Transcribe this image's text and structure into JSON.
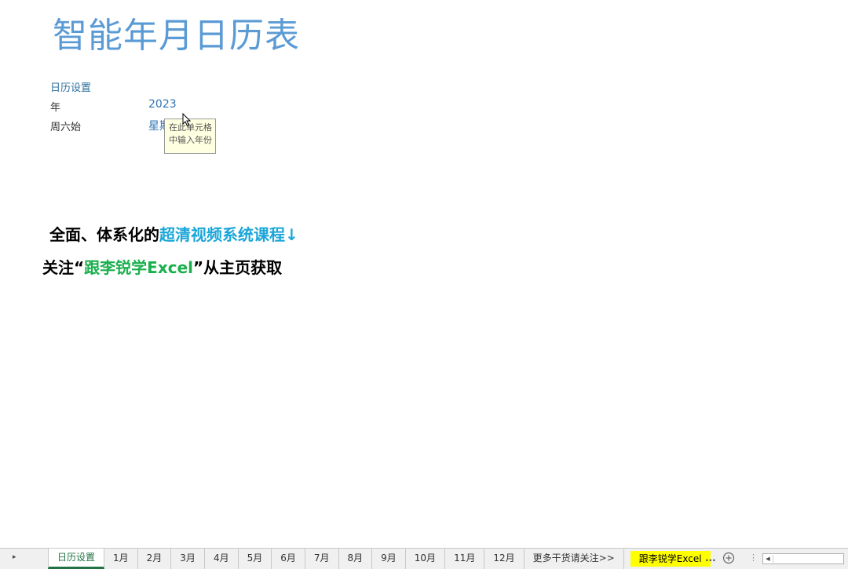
{
  "sheet": {
    "title": "智能年月日历表",
    "settings_heading": "日历设置",
    "rows": [
      {
        "label": "年",
        "value": "2023"
      },
      {
        "label": "周六始",
        "value": "星期"
      }
    ],
    "tooltip": {
      "line1": "在此单元格",
      "line2": "中输入年份"
    },
    "promo": {
      "line1_prefix": "全面、体系化的",
      "line1_highlight": "超清视频系统课程↓",
      "line2_prefix": "关注“",
      "line2_highlight": "跟李锐学Excel",
      "line2_suffix": "”从主页获取"
    }
  },
  "tabbar": {
    "nav_arrow": "▸",
    "tabs": [
      {
        "label": "日历设置",
        "active": true
      },
      {
        "label": "1月"
      },
      {
        "label": "2月"
      },
      {
        "label": "3月"
      },
      {
        "label": "4月"
      },
      {
        "label": "5月"
      },
      {
        "label": "6月"
      },
      {
        "label": "7月"
      },
      {
        "label": "8月"
      },
      {
        "label": "9月"
      },
      {
        "label": "10月"
      },
      {
        "label": "11月"
      },
      {
        "label": "12月"
      },
      {
        "label": "更多干货请关注>>"
      },
      {
        "label": "跟李锐学Excel",
        "highlight": true
      }
    ],
    "more_label": "...",
    "split_handle": "⋮"
  },
  "colors": {
    "title": "#5b9bd5",
    "promo_blue": "#1aa6d8",
    "promo_green": "#1bb04e",
    "active_tab": "#217346",
    "highlight_tab": "#ffff00"
  }
}
